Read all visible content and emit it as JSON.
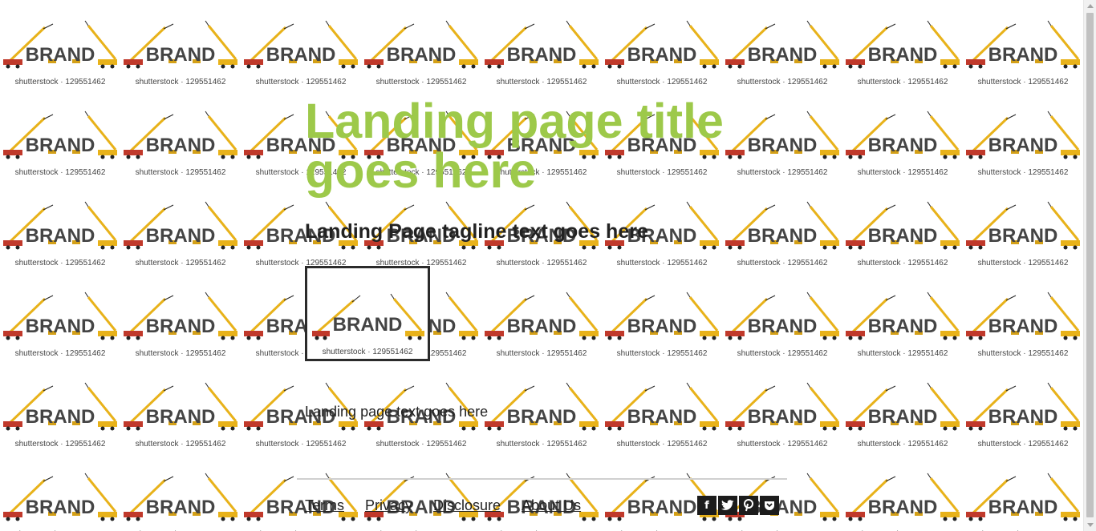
{
  "background": {
    "tile_label": "BRAND",
    "tile_caption": "shutterstock · 129551462"
  },
  "page": {
    "title": "Landing page title goes here",
    "tagline": "Landing Page tagline text goes here",
    "body_text": "Landing page text goes here"
  },
  "hero": {
    "label": "BRAND",
    "caption": "shutterstock · 129551462"
  },
  "footer": {
    "links": [
      "Terms",
      "Privacy",
      "Disclosure",
      "About Us"
    ]
  },
  "social": [
    {
      "name": "facebook-icon",
      "glyph": "f"
    },
    {
      "name": "twitter-icon",
      "glyph": ""
    },
    {
      "name": "pinterest-icon",
      "glyph": ""
    },
    {
      "name": "pocket-icon",
      "glyph": ""
    }
  ],
  "colors": {
    "title": "#9dc94a",
    "crane_yellow": "#e8b21a",
    "crane_red": "#c0392b",
    "social_bg": "#1c1c1c"
  }
}
